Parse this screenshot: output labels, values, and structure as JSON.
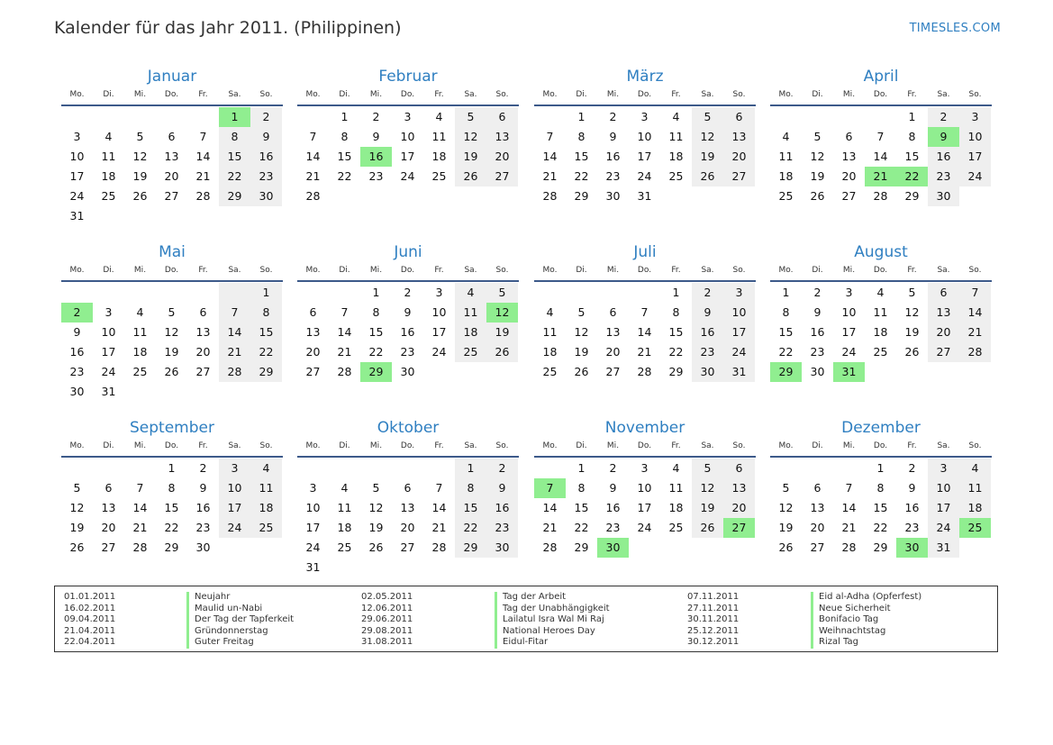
{
  "header": {
    "title": "Kalender für das Jahr 2011. (Philippinen)",
    "site": "TIMESLES.COM"
  },
  "weekdays": [
    "Mo.",
    "Di.",
    "Mi.",
    "Do.",
    "Fr.",
    "Sa.",
    "So."
  ],
  "colors": {
    "accent": "#2f7fc1",
    "holiday": "#90ee90",
    "weekend": "#efefef",
    "rule": "#3d5a8a"
  },
  "months": [
    {
      "name": "Januar",
      "offset": 5,
      "days": 31,
      "holidays": [
        1
      ]
    },
    {
      "name": "Februar",
      "offset": 1,
      "days": 28,
      "holidays": [
        16
      ]
    },
    {
      "name": "März",
      "offset": 1,
      "days": 31,
      "holidays": []
    },
    {
      "name": "April",
      "offset": 4,
      "days": 30,
      "holidays": [
        9,
        21,
        22
      ]
    },
    {
      "name": "Mai",
      "offset": 6,
      "days": 31,
      "holidays": [
        2
      ]
    },
    {
      "name": "Juni",
      "offset": 2,
      "days": 30,
      "holidays": [
        12,
        29
      ]
    },
    {
      "name": "Juli",
      "offset": 4,
      "days": 31,
      "holidays": []
    },
    {
      "name": "August",
      "offset": 0,
      "days": 31,
      "holidays": [
        29,
        31
      ]
    },
    {
      "name": "September",
      "offset": 3,
      "days": 30,
      "holidays": []
    },
    {
      "name": "Oktober",
      "offset": 5,
      "days": 31,
      "holidays": []
    },
    {
      "name": "November",
      "offset": 1,
      "days": 30,
      "holidays": [
        7,
        27,
        30
      ]
    },
    {
      "name": "Dezember",
      "offset": 3,
      "days": 31,
      "holidays": [
        25,
        30
      ]
    }
  ],
  "holiday_list": [
    [
      {
        "date": "01.01.2011",
        "name": "Neujahr"
      },
      {
        "date": "16.02.2011",
        "name": "Maulid un-Nabi"
      },
      {
        "date": "09.04.2011",
        "name": "Der Tag der Tapferkeit"
      },
      {
        "date": "21.04.2011",
        "name": "Gründonnerstag"
      },
      {
        "date": "22.04.2011",
        "name": "Guter Freitag"
      }
    ],
    [
      {
        "date": "02.05.2011",
        "name": "Tag der Arbeit"
      },
      {
        "date": "12.06.2011",
        "name": "Tag der Unabhängigkeit"
      },
      {
        "date": "29.06.2011",
        "name": "Lailatul Isra Wal Mi Raj"
      },
      {
        "date": "29.08.2011",
        "name": "National Heroes Day"
      },
      {
        "date": "31.08.2011",
        "name": "Eidul-Fitar"
      }
    ],
    [
      {
        "date": "07.11.2011",
        "name": "Eid al-Adha (Opferfest)"
      },
      {
        "date": "27.11.2011",
        "name": "Neue Sicherheit"
      },
      {
        "date": "30.11.2011",
        "name": "Bonifacio Tag"
      },
      {
        "date": "25.12.2011",
        "name": "Weihnachtstag"
      },
      {
        "date": "30.12.2011",
        "name": "Rizal Tag"
      }
    ]
  ]
}
